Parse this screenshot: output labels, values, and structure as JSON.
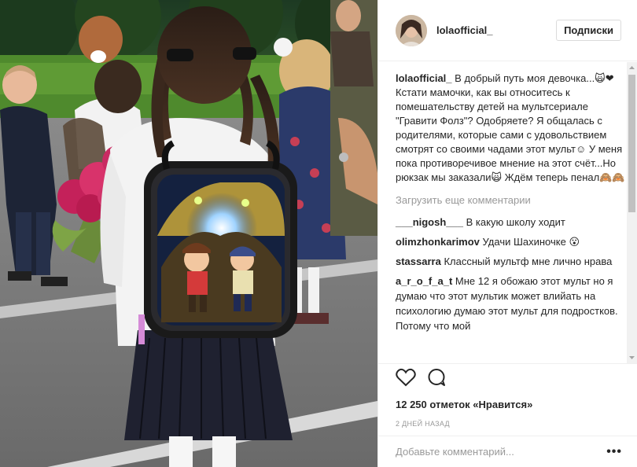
{
  "post": {
    "username": "lolaofficial_",
    "follow_label": "Подписки",
    "caption": "В добрый путь моя девочка...🙀❤ Кстати мамочки, как вы относитесь к помешательству детей на мультсериале \"Гравити Фолз\"? Одобряете? Я общалась с родителями, которые сами с удовольствием смотрят со своими чадами этот мульт☺ У меня пока противоречивое мнение на этот счёт...Но рюкзак мы заказали🙀 Ждём теперь пенал🙈🙈",
    "load_more_label": "Загрузить еще комментарии",
    "comments": [
      {
        "user": "___nigosh___",
        "text": "В какую школу ходит"
      },
      {
        "user": "olimzhonkarimov",
        "text": "Удачи Шахиночке 😮"
      },
      {
        "user": "stassarra",
        "text": "Классный мультф мне лично нрава"
      },
      {
        "user": "a_r_o_f_a_t",
        "text": "Мне 12 я обожаю этот мульт но я думаю что этот мультик может влийать на психологию думаю этот мульт для подростков. Потому что мой"
      }
    ],
    "likes_text": "12 250 отметок «Нравится»",
    "timestamp": "2 ДНЕЙ НАЗАД",
    "comment_placeholder": "Добавьте комментарий...",
    "more_icon": "more-options-icon",
    "like_icon": "heart-icon",
    "comment_icon": "comment-bubble-icon"
  }
}
